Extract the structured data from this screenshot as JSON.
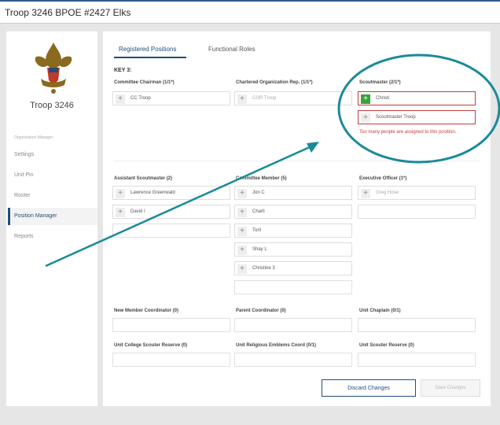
{
  "header": {
    "title": "Troop 3246 BPOE #2427 Elks"
  },
  "sidebar": {
    "troop_name": "Troop 3246",
    "section_header": "Organization Manager",
    "items": [
      {
        "label": "Settings"
      },
      {
        "label": "Unit Pin"
      },
      {
        "label": "Roster"
      },
      {
        "label": "Position Manager"
      },
      {
        "label": "Reports"
      }
    ]
  },
  "tabs": [
    {
      "label": "Registered Positions",
      "active": true
    },
    {
      "label": "Functional Roles",
      "active": false
    }
  ],
  "key_label": "KEY 3:",
  "positions": {
    "committee_chairman": {
      "title": "Committee Chairman (1/1*)",
      "members": [
        "CC Troop"
      ]
    },
    "chartered_org_rep": {
      "title": "Chartered Organization Rep. (1/1*)",
      "members": [
        "COR Troop"
      ]
    },
    "scoutmaster": {
      "title": "Scoutmaster (2/1*)",
      "members": [
        "Christi",
        "Scoutmaster Troop"
      ],
      "error": "Too many people are assigned to this position."
    },
    "assistant_scoutmaster": {
      "title": "Assistant Scoutmaster (2)",
      "members": [
        "Lawrence Greenwald",
        "David I"
      ]
    },
    "committee_member": {
      "title": "Committee Member (5)",
      "members": [
        "Jon C",
        "Charli",
        "Torli",
        "Shay L",
        "Christine 3"
      ]
    },
    "executive_officer": {
      "title": "Executive Officer (1*)",
      "members": [
        "Greg Hose"
      ]
    },
    "new_member_coordinator": {
      "title": "New Member Coordinator (0)"
    },
    "parent_coordinator": {
      "title": "Parent Coordinator (0)"
    },
    "unit_chaplain": {
      "title": "Unit Chaplain (0/1)"
    },
    "unit_college_scouter_reserve": {
      "title": "Unit College Scouter Reserve (0)"
    },
    "unit_religious_emblems_coord": {
      "title": "Unit Religious Emblems Coord (0/1)"
    },
    "unit_scouter_reserve": {
      "title": "Unit Scouter Reserve (0)"
    }
  },
  "buttons": {
    "discard": "Discard Changes",
    "save": "Save Changes"
  },
  "colors": {
    "accent": "#1f4e79",
    "error": "#c43c3c",
    "add_green": "#37a33b",
    "annotation": "#1a8a99"
  }
}
